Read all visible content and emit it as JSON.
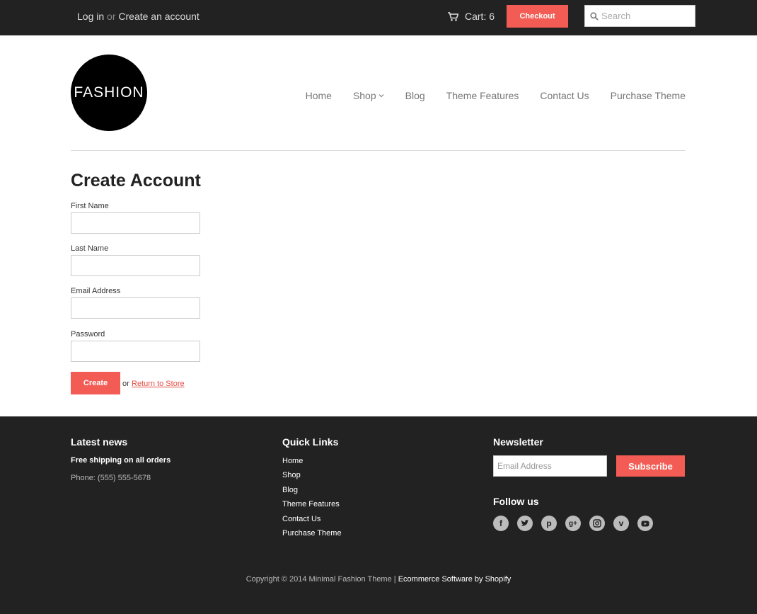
{
  "topbar": {
    "login": "Log in",
    "or": "or",
    "create_account": "Create an account",
    "cart_label": "Cart: 6",
    "checkout_label": "Checkout",
    "search_placeholder": "Search"
  },
  "header": {
    "logo_text": "FASHION",
    "nav": [
      "Home",
      "Shop",
      "Blog",
      "Theme Features",
      "Contact Us",
      "Purchase Theme"
    ]
  },
  "form": {
    "title": "Create Account",
    "fields": [
      {
        "label": "First Name",
        "value": ""
      },
      {
        "label": "Last Name",
        "value": ""
      },
      {
        "label": "Email Address",
        "value": ""
      },
      {
        "label": "Password",
        "value": ""
      }
    ],
    "create_label": "Create",
    "or": "or",
    "return_label": "Return to Store"
  },
  "footer": {
    "latest_news_title": "Latest news",
    "news_lines": [
      "Free shipping on all orders",
      "Phone: (555) 555-5678"
    ],
    "quick_links_title": "Quick Links",
    "quick_links": [
      "Home",
      "Shop",
      "Blog",
      "Theme Features",
      "Contact Us",
      "Purchase Theme"
    ],
    "newsletter_title": "Newsletter",
    "newsletter_placeholder": "Email Address",
    "subscribe_label": "Subscribe",
    "follow_title": "Follow us",
    "socials": [
      "facebook-icon",
      "twitter-icon",
      "pinterest-icon",
      "google-plus-icon",
      "instagram-icon",
      "vimeo-icon",
      "youtube-icon"
    ],
    "copyright_prefix": "Copyright © 2014 Minimal Fashion Theme |",
    "copyright_link": "Ecommerce Software by Shopify"
  },
  "colors": {
    "accent": "#f25c54",
    "dark_bg": "#222222"
  }
}
